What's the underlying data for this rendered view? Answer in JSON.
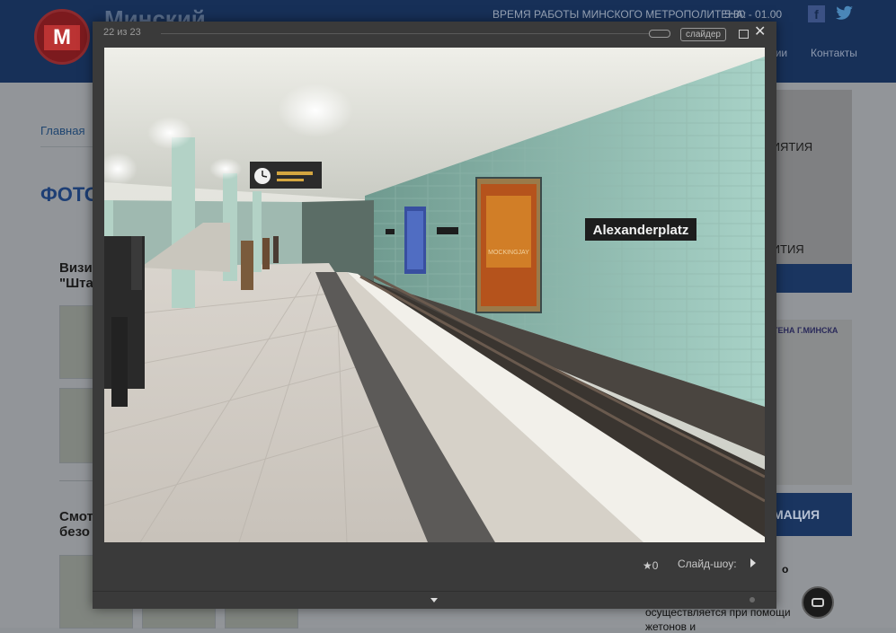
{
  "site": {
    "title": "Минский",
    "logo_letter": "M",
    "work_hours_label": "ВРЕМЯ РАБОТЫ МИНСКОГО МЕТРОПОЛИТЕНА:",
    "work_hours_value": "5:30 - 01.00",
    "nav_partial": "исии",
    "nav_contacts": "Контакты",
    "breadcrumb_home": "Главная",
    "page_heading_partial": "ФОТО",
    "section1_line1": "Визи",
    "section1_line2": "\"Шта",
    "section2_line1": "Смот",
    "section2_line2": "безо",
    "right_item_1": "РИЯТИЯ",
    "right_item_2": "Я",
    "right_item_3": "ВИТИЯ",
    "right_bar_2": "МАЦИЯ",
    "map_title": "ТЕНА Г.МИНСКА",
    "right_text_1": "о",
    "right_text_2": "осуществляется при помощи",
    "right_text_3": "жетонов и"
  },
  "lightbox": {
    "counter": "22 из 23",
    "slider_button": "слайдер",
    "rating_count": "0",
    "slideshow_label": "Слайд-шоу:",
    "photo": {
      "station_sign": "Alexanderplatz",
      "poster_text": "MOCKINGJAY"
    }
  },
  "colors": {
    "header_bg": "#173058",
    "lightbox_bg": "#3a3a3a",
    "accent_blue": "#1a3560"
  }
}
